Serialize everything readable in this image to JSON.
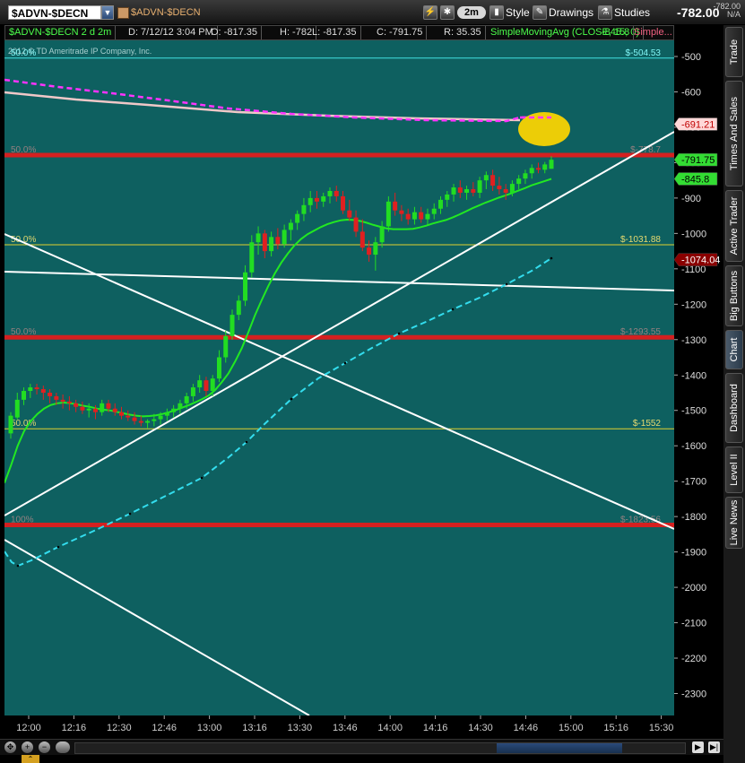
{
  "toolbar": {
    "symbol": "$ADVN-$DECN",
    "symbol_desc": "$ADVN-$DECN",
    "aggregation": "2m",
    "style_label": "Style",
    "drawings_label": "Drawings",
    "studies_label": "Studies",
    "last_price": "-782.00",
    "net_change": "-782.00",
    "pct_change": "N/A"
  },
  "info_bar": {
    "title": "$ADVN-$DECN 2 d 2m",
    "datetime": "D: 7/12/12 3:04 PM",
    "open": "O: -817.35",
    "high": "H: -782",
    "low": "L: -817.35",
    "close": "C: -791.75",
    "range": "R: 35.35",
    "study": "SimpleMovingAvg (CLOSE, 15, 0)",
    "study_value": "-845.8",
    "study2": "Simple..."
  },
  "side_tabs": [
    "Trade",
    "Times And Sales",
    "Active Trader",
    "Big Buttons",
    "Chart",
    "Dashboard",
    "Level II",
    "Live News"
  ],
  "colors": {
    "chart_bg": "#0e6060",
    "up_candle": "#22dd22",
    "down_candle": "#e02020",
    "sma15": "#22e822",
    "fib_red": "#d42020",
    "fib_yellow": "#e0d030",
    "trend_white": "#ffffff",
    "cyan_dash": "#33ddee",
    "magenta_dash": "#ff33ff",
    "pink_line": "#f0c8c8",
    "highlight_yellow": "#ffd700"
  },
  "chart_data": {
    "type": "candlestick",
    "watermark": "2012 © TD Ameritrade IP Company, Inc.",
    "ylim": [
      -2390,
      -395
    ],
    "yticks": [
      -500,
      -600,
      -700,
      -800,
      -900,
      -1000,
      -1100,
      -1200,
      -1300,
      -1400,
      -1500,
      -1600,
      -1700,
      -1800,
      -1900,
      -2000,
      -2100,
      -2200,
      -2300
    ],
    "xticks": [
      "12:00",
      "12:16",
      "12:30",
      "12:46",
      "13:00",
      "13:16",
      "13:30",
      "13:46",
      "14:00",
      "14:16",
      "14:30",
      "14:46",
      "15:00",
      "15:16",
      "15:30"
    ],
    "fib_levels": [
      {
        "pct": "50.0%",
        "value": -504.53,
        "label": "$-504.53",
        "color": "cyan",
        "width": 1
      },
      {
        "pct": "50.0%",
        "value": -778.7,
        "label": "$-778.7",
        "color": "red",
        "width": 5
      },
      {
        "pct": "50.0%",
        "value": -1031.88,
        "label": "$-1031.88",
        "color": "yellow",
        "width": 1
      },
      {
        "pct": "50.0%",
        "value": -1293.55,
        "label": "$-1293.55",
        "color": "red",
        "width": 5
      },
      {
        "pct": "50.0%",
        "value": -1552,
        "label": "$-1552",
        "color": "yellow",
        "width": 1
      },
      {
        "pct": "100%",
        "value": -1823.56,
        "label": "$-1823.56",
        "color": "red",
        "width": 5
      }
    ],
    "price_bubbles": [
      {
        "value": -691.21,
        "label": "-691.21",
        "bg": "#ffd8d8",
        "fg": "#c00000"
      },
      {
        "value": -791.75,
        "label": "-791.75",
        "bg": "#33dd33",
        "fg": "#000000"
      },
      {
        "value": -845.8,
        "label": "-845.8",
        "bg": "#33dd33",
        "fg": "#000000"
      },
      {
        "value": -1074.04,
        "label": "-1074.04",
        "bg": "#8a0000",
        "fg": "#ffffff"
      }
    ],
    "candles": [
      {
        "o": -1565,
        "h": -1505,
        "l": -1580,
        "c": -1515
      },
      {
        "o": -1520,
        "h": -1450,
        "l": -1525,
        "c": -1470
      },
      {
        "o": -1470,
        "h": -1435,
        "l": -1485,
        "c": -1445
      },
      {
        "o": -1445,
        "h": -1425,
        "l": -1465,
        "c": -1435
      },
      {
        "o": -1435,
        "h": -1425,
        "l": -1455,
        "c": -1440
      },
      {
        "o": -1440,
        "h": -1430,
        "l": -1470,
        "c": -1450
      },
      {
        "o": -1450,
        "h": -1440,
        "l": -1480,
        "c": -1460
      },
      {
        "o": -1460,
        "h": -1450,
        "l": -1485,
        "c": -1470
      },
      {
        "o": -1470,
        "h": -1455,
        "l": -1495,
        "c": -1475
      },
      {
        "o": -1475,
        "h": -1460,
        "l": -1500,
        "c": -1480
      },
      {
        "o": -1480,
        "h": -1470,
        "l": -1505,
        "c": -1490
      },
      {
        "o": -1490,
        "h": -1475,
        "l": -1510,
        "c": -1500
      },
      {
        "o": -1500,
        "h": -1480,
        "l": -1520,
        "c": -1495
      },
      {
        "o": -1495,
        "h": -1485,
        "l": -1525,
        "c": -1505
      },
      {
        "o": -1505,
        "h": -1470,
        "l": -1515,
        "c": -1480
      },
      {
        "o": -1480,
        "h": -1470,
        "l": -1505,
        "c": -1495
      },
      {
        "o": -1495,
        "h": -1480,
        "l": -1515,
        "c": -1505
      },
      {
        "o": -1505,
        "h": -1490,
        "l": -1525,
        "c": -1515
      },
      {
        "o": -1515,
        "h": -1500,
        "l": -1530,
        "c": -1520
      },
      {
        "o": -1520,
        "h": -1505,
        "l": -1540,
        "c": -1530
      },
      {
        "o": -1530,
        "h": -1515,
        "l": -1545,
        "c": -1535
      },
      {
        "o": -1535,
        "h": -1525,
        "l": -1550,
        "c": -1530
      },
      {
        "o": -1530,
        "h": -1510,
        "l": -1545,
        "c": -1525
      },
      {
        "o": -1525,
        "h": -1505,
        "l": -1540,
        "c": -1515
      },
      {
        "o": -1515,
        "h": -1495,
        "l": -1530,
        "c": -1505
      },
      {
        "o": -1505,
        "h": -1485,
        "l": -1520,
        "c": -1495
      },
      {
        "o": -1495,
        "h": -1470,
        "l": -1510,
        "c": -1480
      },
      {
        "o": -1480,
        "h": -1450,
        "l": -1495,
        "c": -1460
      },
      {
        "o": -1460,
        "h": -1425,
        "l": -1475,
        "c": -1435
      },
      {
        "o": -1435,
        "h": -1400,
        "l": -1450,
        "c": -1415
      },
      {
        "o": -1415,
        "h": -1405,
        "l": -1460,
        "c": -1445
      },
      {
        "o": -1445,
        "h": -1400,
        "l": -1460,
        "c": -1410
      },
      {
        "o": -1410,
        "h": -1330,
        "l": -1420,
        "c": -1350
      },
      {
        "o": -1350,
        "h": -1275,
        "l": -1365,
        "c": -1290
      },
      {
        "o": -1290,
        "h": -1215,
        "l": -1300,
        "c": -1230
      },
      {
        "o": -1230,
        "h": -1175,
        "l": -1245,
        "c": -1190
      },
      {
        "o": -1190,
        "h": -1090,
        "l": -1205,
        "c": -1110
      },
      {
        "o": -1110,
        "h": -1005,
        "l": -1125,
        "c": -1025
      },
      {
        "o": -1025,
        "h": -980,
        "l": -1060,
        "c": -1000
      },
      {
        "o": -1000,
        "h": -990,
        "l": -1070,
        "c": -1050
      },
      {
        "o": -1050,
        "h": -995,
        "l": -1065,
        "c": -1010
      },
      {
        "o": -1010,
        "h": -985,
        "l": -1045,
        "c": -1030
      },
      {
        "o": -1030,
        "h": -975,
        "l": -1040,
        "c": -990
      },
      {
        "o": -990,
        "h": -960,
        "l": -1020,
        "c": -970
      },
      {
        "o": -970,
        "h": -935,
        "l": -990,
        "c": -945
      },
      {
        "o": -945,
        "h": -900,
        "l": -965,
        "c": -920
      },
      {
        "o": -920,
        "h": -880,
        "l": -940,
        "c": -900
      },
      {
        "o": -900,
        "h": -880,
        "l": -930,
        "c": -910
      },
      {
        "o": -910,
        "h": -885,
        "l": -925,
        "c": -895
      },
      {
        "o": -895,
        "h": -870,
        "l": -915,
        "c": -880
      },
      {
        "o": -880,
        "h": -865,
        "l": -910,
        "c": -895
      },
      {
        "o": -895,
        "h": -880,
        "l": -945,
        "c": -935
      },
      {
        "o": -935,
        "h": -905,
        "l": -965,
        "c": -955
      },
      {
        "o": -955,
        "h": -935,
        "l": -1010,
        "c": -995
      },
      {
        "o": -995,
        "h": -960,
        "l": -1050,
        "c": -1040
      },
      {
        "o": -1040,
        "h": -1020,
        "l": -1080,
        "c": -1060
      },
      {
        "o": -1060,
        "h": -1010,
        "l": -1105,
        "c": -1025
      },
      {
        "o": -1025,
        "h": -965,
        "l": -1040,
        "c": -980
      },
      {
        "o": -980,
        "h": -895,
        "l": -995,
        "c": -910
      },
      {
        "o": -910,
        "h": -885,
        "l": -950,
        "c": -935
      },
      {
        "o": -935,
        "h": -920,
        "l": -965,
        "c": -945
      },
      {
        "o": -945,
        "h": -930,
        "l": -975,
        "c": -960
      },
      {
        "o": -960,
        "h": -925,
        "l": -975,
        "c": -940
      },
      {
        "o": -940,
        "h": -925,
        "l": -970,
        "c": -960
      },
      {
        "o": -960,
        "h": -930,
        "l": -975,
        "c": -945
      },
      {
        "o": -945,
        "h": -915,
        "l": -960,
        "c": -930
      },
      {
        "o": -930,
        "h": -895,
        "l": -945,
        "c": -905
      },
      {
        "o": -905,
        "h": -880,
        "l": -925,
        "c": -890
      },
      {
        "o": -890,
        "h": -860,
        "l": -910,
        "c": -870
      },
      {
        "o": -870,
        "h": -850,
        "l": -900,
        "c": -885
      },
      {
        "o": -885,
        "h": -865,
        "l": -905,
        "c": -875
      },
      {
        "o": -875,
        "h": -855,
        "l": -895,
        "c": -885
      },
      {
        "o": -885,
        "h": -840,
        "l": -900,
        "c": -850
      },
      {
        "o": -850,
        "h": -825,
        "l": -875,
        "c": -835
      },
      {
        "o": -835,
        "h": -820,
        "l": -880,
        "c": -865
      },
      {
        "o": -865,
        "h": -840,
        "l": -890,
        "c": -875
      },
      {
        "o": -875,
        "h": -860,
        "l": -905,
        "c": -885
      },
      {
        "o": -885,
        "h": -850,
        "l": -895,
        "c": -860
      },
      {
        "o": -860,
        "h": -835,
        "l": -875,
        "c": -845
      },
      {
        "o": -845,
        "h": -820,
        "l": -860,
        "c": -830
      },
      {
        "o": -830,
        "h": -805,
        "l": -845,
        "c": -815
      },
      {
        "o": -815,
        "h": -800,
        "l": -830,
        "c": -820
      },
      {
        "o": -820,
        "h": -798,
        "l": -830,
        "c": -805
      },
      {
        "o": -817.35,
        "h": -782,
        "l": -817.35,
        "c": -791.75
      }
    ],
    "sma15": [
      -1705,
      -1655,
      -1600,
      -1558,
      -1530,
      -1510,
      -1495,
      -1485,
      -1480,
      -1478,
      -1480,
      -1483,
      -1487,
      -1490,
      -1495,
      -1498,
      -1500,
      -1504,
      -1508,
      -1512,
      -1515,
      -1517,
      -1516,
      -1514,
      -1510,
      -1505,
      -1499,
      -1492,
      -1485,
      -1477,
      -1468,
      -1458,
      -1442,
      -1420,
      -1395,
      -1362,
      -1325,
      -1280,
      -1232,
      -1190,
      -1150,
      -1114,
      -1083,
      -1057,
      -1034,
      -1016,
      -1002,
      -992,
      -982,
      -974,
      -968,
      -963,
      -961,
      -962,
      -965,
      -970,
      -976,
      -981,
      -986,
      -988,
      -988,
      -988,
      -987,
      -983,
      -978,
      -972,
      -967,
      -962,
      -955,
      -947,
      -938,
      -929,
      -921,
      -913,
      -906,
      -899,
      -893,
      -886,
      -879,
      -872,
      -864,
      -858,
      -852,
      -845.8
    ]
  }
}
